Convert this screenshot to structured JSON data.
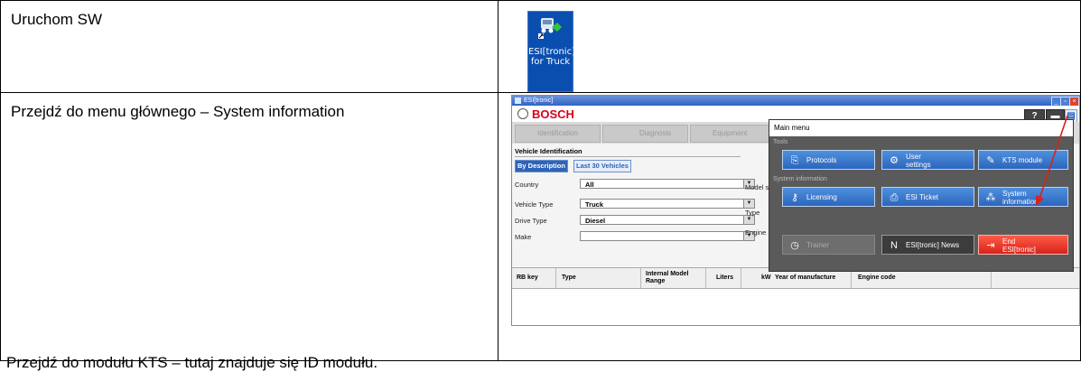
{
  "steps": [
    {
      "instruction": "Uruchom SW"
    },
    {
      "instruction": "Przejdź do menu głównego – System information"
    }
  ],
  "footer_instruction": "Przejdź do modułu KTS – tutaj znajduje się ID modułu.",
  "desktop_icon": {
    "label": "ESI[tronic] for Truck",
    "icon": "truck-app-icon"
  },
  "app": {
    "window_title": "ESI[tronic]",
    "brand": "BOSCH",
    "help_label": "?",
    "vehicle_identification": "Vehicle Identification",
    "tabs": [
      "By Description",
      "Last 30 Vehicles"
    ],
    "nav_tabs": [
      "Identification",
      "Diagnosis",
      "Equipment"
    ],
    "filters": [
      {
        "label": "Country",
        "value": "All"
      },
      {
        "label": "Vehicle Type",
        "value": "Truck"
      },
      {
        "label": "Drive Type",
        "value": "Diesel"
      },
      {
        "label": "Make",
        "value": ""
      }
    ],
    "right_labels": [
      "Model se",
      "Type",
      "Engine"
    ],
    "columns": [
      "RB key",
      "Type",
      "Internal Model Range",
      "Liters",
      "kW",
      "Year of manufacture",
      "Engine code"
    ]
  },
  "main_menu": {
    "title": "Main menu",
    "sections": [
      "Tools",
      "System information"
    ],
    "buttons": {
      "protocols": "Protocols",
      "user_settings": "User settings",
      "kts_module": "KTS module",
      "licensing": "Licensing",
      "esi_ticket": "ESI Ticket",
      "system_information": "System information",
      "trainer": "Trainer",
      "esi_news": "ESI[tronic] News",
      "end_esi": "End ESI[tronic]"
    }
  },
  "colors": {
    "accent": "#2e63b8",
    "brand_red": "#d7001b",
    "annotation_arrow": "#d7231a"
  }
}
